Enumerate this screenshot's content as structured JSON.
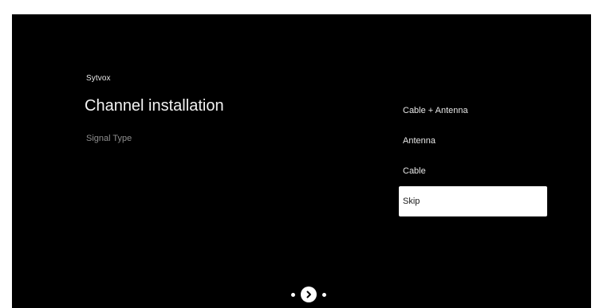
{
  "brand": "Sytvox",
  "title": "Channel installation",
  "subtitle": "Signal Type",
  "options": [
    {
      "label": "Cable + Antenna",
      "selected": false
    },
    {
      "label": "Antenna",
      "selected": false
    },
    {
      "label": "Cable",
      "selected": false
    },
    {
      "label": "Skip",
      "selected": true
    }
  ],
  "navigation": {
    "next_icon": "chevron-right-icon",
    "progress_dots": 2
  },
  "colors": {
    "background": "#000000",
    "selected_background": "#ffffff",
    "selected_text": "#1a1a1a"
  }
}
